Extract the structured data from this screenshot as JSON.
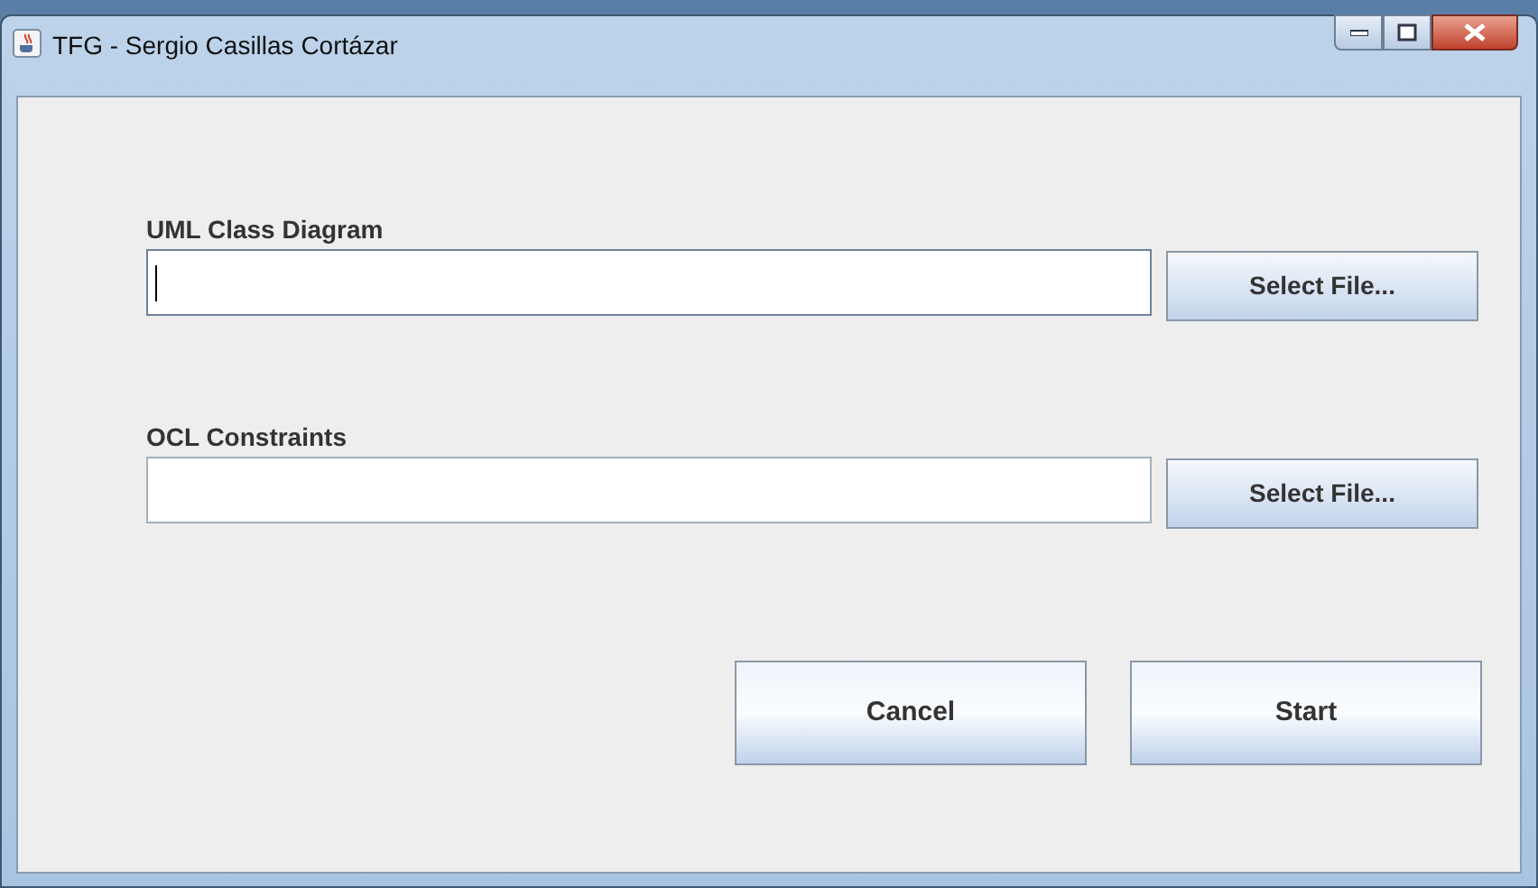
{
  "window": {
    "title": "TFG - Sergio Casillas Cortázar"
  },
  "fields": [
    {
      "label": "UML Class Diagram",
      "focused": true,
      "button": "Select File..."
    },
    {
      "label": "OCL Constraints",
      "focused": false,
      "button": "Select File..."
    }
  ],
  "buttons": [
    "Cancel",
    "Start"
  ]
}
